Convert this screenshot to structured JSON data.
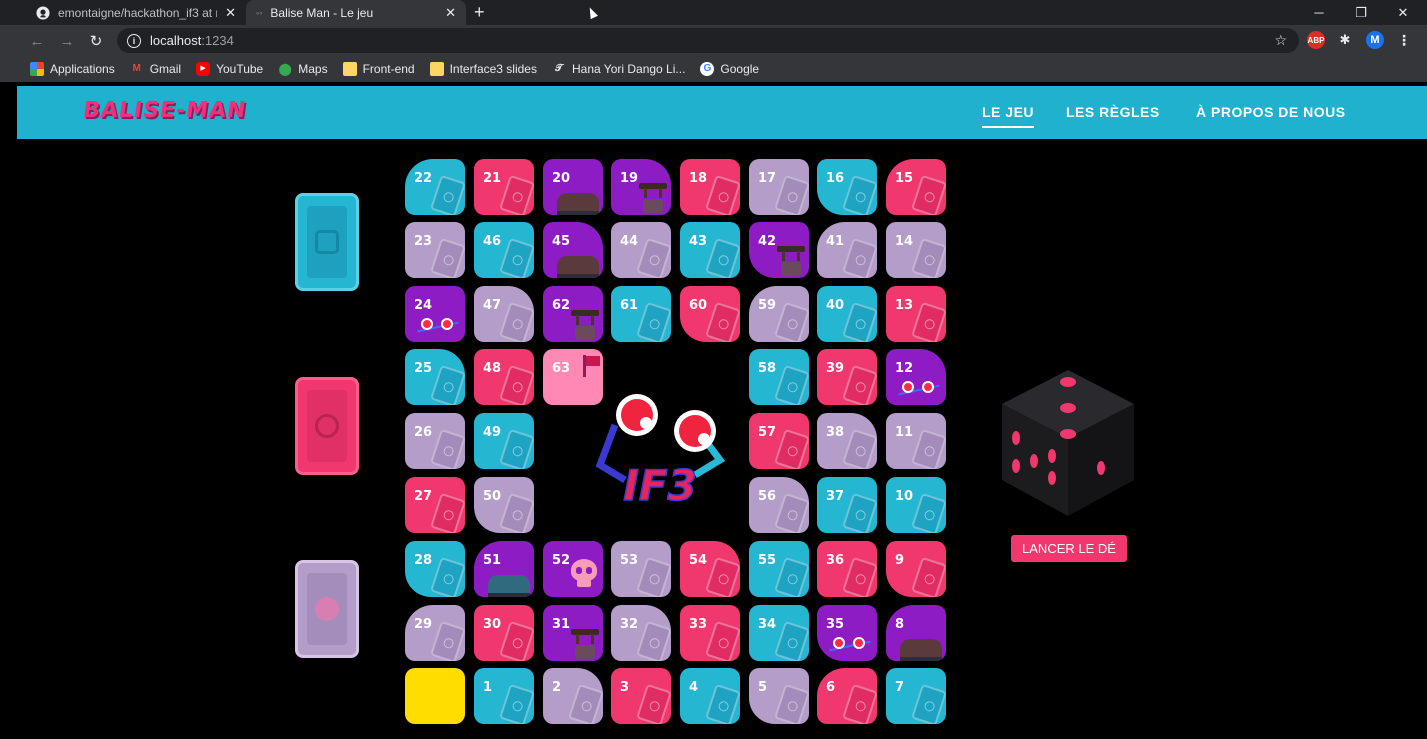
{
  "browser": {
    "tabs": [
      {
        "title": "emontaigne/hackathon_if3 at ma",
        "active": false
      },
      {
        "title": "Balise Man - Le jeu",
        "active": true
      }
    ],
    "address": {
      "host": "localhost",
      "port": ":1234"
    },
    "extensions": [
      "ABP",
      "puzzle-icon",
      "M"
    ],
    "bookmarks": [
      "Applications",
      "Gmail",
      "YouTube",
      "Maps",
      "Front-end",
      "Interface3 slides",
      "Hana Yori Dango Li...",
      "Google"
    ]
  },
  "site": {
    "logo": "BALISE-MAN",
    "nav": [
      {
        "label": "LE JEU",
        "active": true
      },
      {
        "label": "LES RÈGLES",
        "active": false
      },
      {
        "label": "À PROPOS DE NOUS",
        "active": false
      }
    ]
  },
  "game": {
    "card_stacks": [
      "blue",
      "pink",
      "lilac"
    ],
    "board": [
      {
        "n": "22",
        "color": "blue"
      },
      {
        "n": "21",
        "color": "pink"
      },
      {
        "n": "20",
        "color": "purple",
        "deco": "hut"
      },
      {
        "n": "19",
        "color": "purple",
        "deco": "well"
      },
      {
        "n": "18",
        "color": "pink"
      },
      {
        "n": "17",
        "color": "lilac"
      },
      {
        "n": "16",
        "color": "blue"
      },
      {
        "n": "15",
        "color": "pink"
      },
      {
        "n": "23",
        "color": "lilac"
      },
      {
        "n": "46",
        "color": "blue"
      },
      {
        "n": "45",
        "color": "purple",
        "deco": "hut"
      },
      {
        "n": "44",
        "color": "lilac"
      },
      {
        "n": "43",
        "color": "blue"
      },
      {
        "n": "42",
        "color": "purple",
        "deco": "well"
      },
      {
        "n": "41",
        "color": "lilac"
      },
      {
        "n": "14",
        "color": "lilac"
      },
      {
        "n": "24",
        "color": "purple",
        "deco": "eyes"
      },
      {
        "n": "47",
        "color": "lilac"
      },
      {
        "n": "62",
        "color": "purple",
        "deco": "well"
      },
      {
        "n": "61",
        "color": "blue"
      },
      {
        "n": "60",
        "color": "pink"
      },
      {
        "n": "59",
        "color": "lilac"
      },
      {
        "n": "40",
        "color": "blue"
      },
      {
        "n": "13",
        "color": "pink"
      },
      {
        "n": "25",
        "color": "blue"
      },
      {
        "n": "48",
        "color": "pink"
      },
      {
        "n": "63",
        "color": "lightpink",
        "deco": "flag"
      },
      {
        "n": "",
        "color": "none"
      },
      {
        "n": "",
        "color": "none"
      },
      {
        "n": "58",
        "color": "blue"
      },
      {
        "n": "39",
        "color": "pink"
      },
      {
        "n": "12",
        "color": "purple",
        "deco": "eyes"
      },
      {
        "n": "26",
        "color": "lilac"
      },
      {
        "n": "49",
        "color": "blue"
      },
      {
        "n": "",
        "color": "none"
      },
      {
        "n": "",
        "color": "none"
      },
      {
        "n": "",
        "color": "none"
      },
      {
        "n": "57",
        "color": "pink"
      },
      {
        "n": "38",
        "color": "lilac"
      },
      {
        "n": "11",
        "color": "lilac"
      },
      {
        "n": "27",
        "color": "pink"
      },
      {
        "n": "50",
        "color": "lilac"
      },
      {
        "n": "",
        "color": "none"
      },
      {
        "n": "",
        "color": "none"
      },
      {
        "n": "",
        "color": "none"
      },
      {
        "n": "56",
        "color": "lilac"
      },
      {
        "n": "37",
        "color": "blue"
      },
      {
        "n": "10",
        "color": "blue"
      },
      {
        "n": "28",
        "color": "blue"
      },
      {
        "n": "51",
        "color": "purple",
        "deco": "hut-blue"
      },
      {
        "n": "52",
        "color": "purple",
        "deco": "skull"
      },
      {
        "n": "53",
        "color": "lilac"
      },
      {
        "n": "54",
        "color": "pink"
      },
      {
        "n": "55",
        "color": "blue"
      },
      {
        "n": "36",
        "color": "pink"
      },
      {
        "n": "9",
        "color": "pink"
      },
      {
        "n": "29",
        "color": "lilac"
      },
      {
        "n": "30",
        "color": "pink"
      },
      {
        "n": "31",
        "color": "purple",
        "deco": "well"
      },
      {
        "n": "32",
        "color": "lilac"
      },
      {
        "n": "33",
        "color": "pink"
      },
      {
        "n": "34",
        "color": "blue"
      },
      {
        "n": "35",
        "color": "purple",
        "deco": "eyes"
      },
      {
        "n": "8",
        "color": "purple",
        "deco": "hut"
      },
      {
        "n": "",
        "color": "yellow"
      },
      {
        "n": "1",
        "color": "blue"
      },
      {
        "n": "2",
        "color": "lilac"
      },
      {
        "n": "3",
        "color": "pink"
      },
      {
        "n": "4",
        "color": "blue"
      },
      {
        "n": "5",
        "color": "lilac"
      },
      {
        "n": "6",
        "color": "pink"
      },
      {
        "n": "7",
        "color": "blue"
      }
    ],
    "mascot_text": "IF3",
    "dice_face": 5,
    "roll_button": "LANCER LE DÉ"
  }
}
